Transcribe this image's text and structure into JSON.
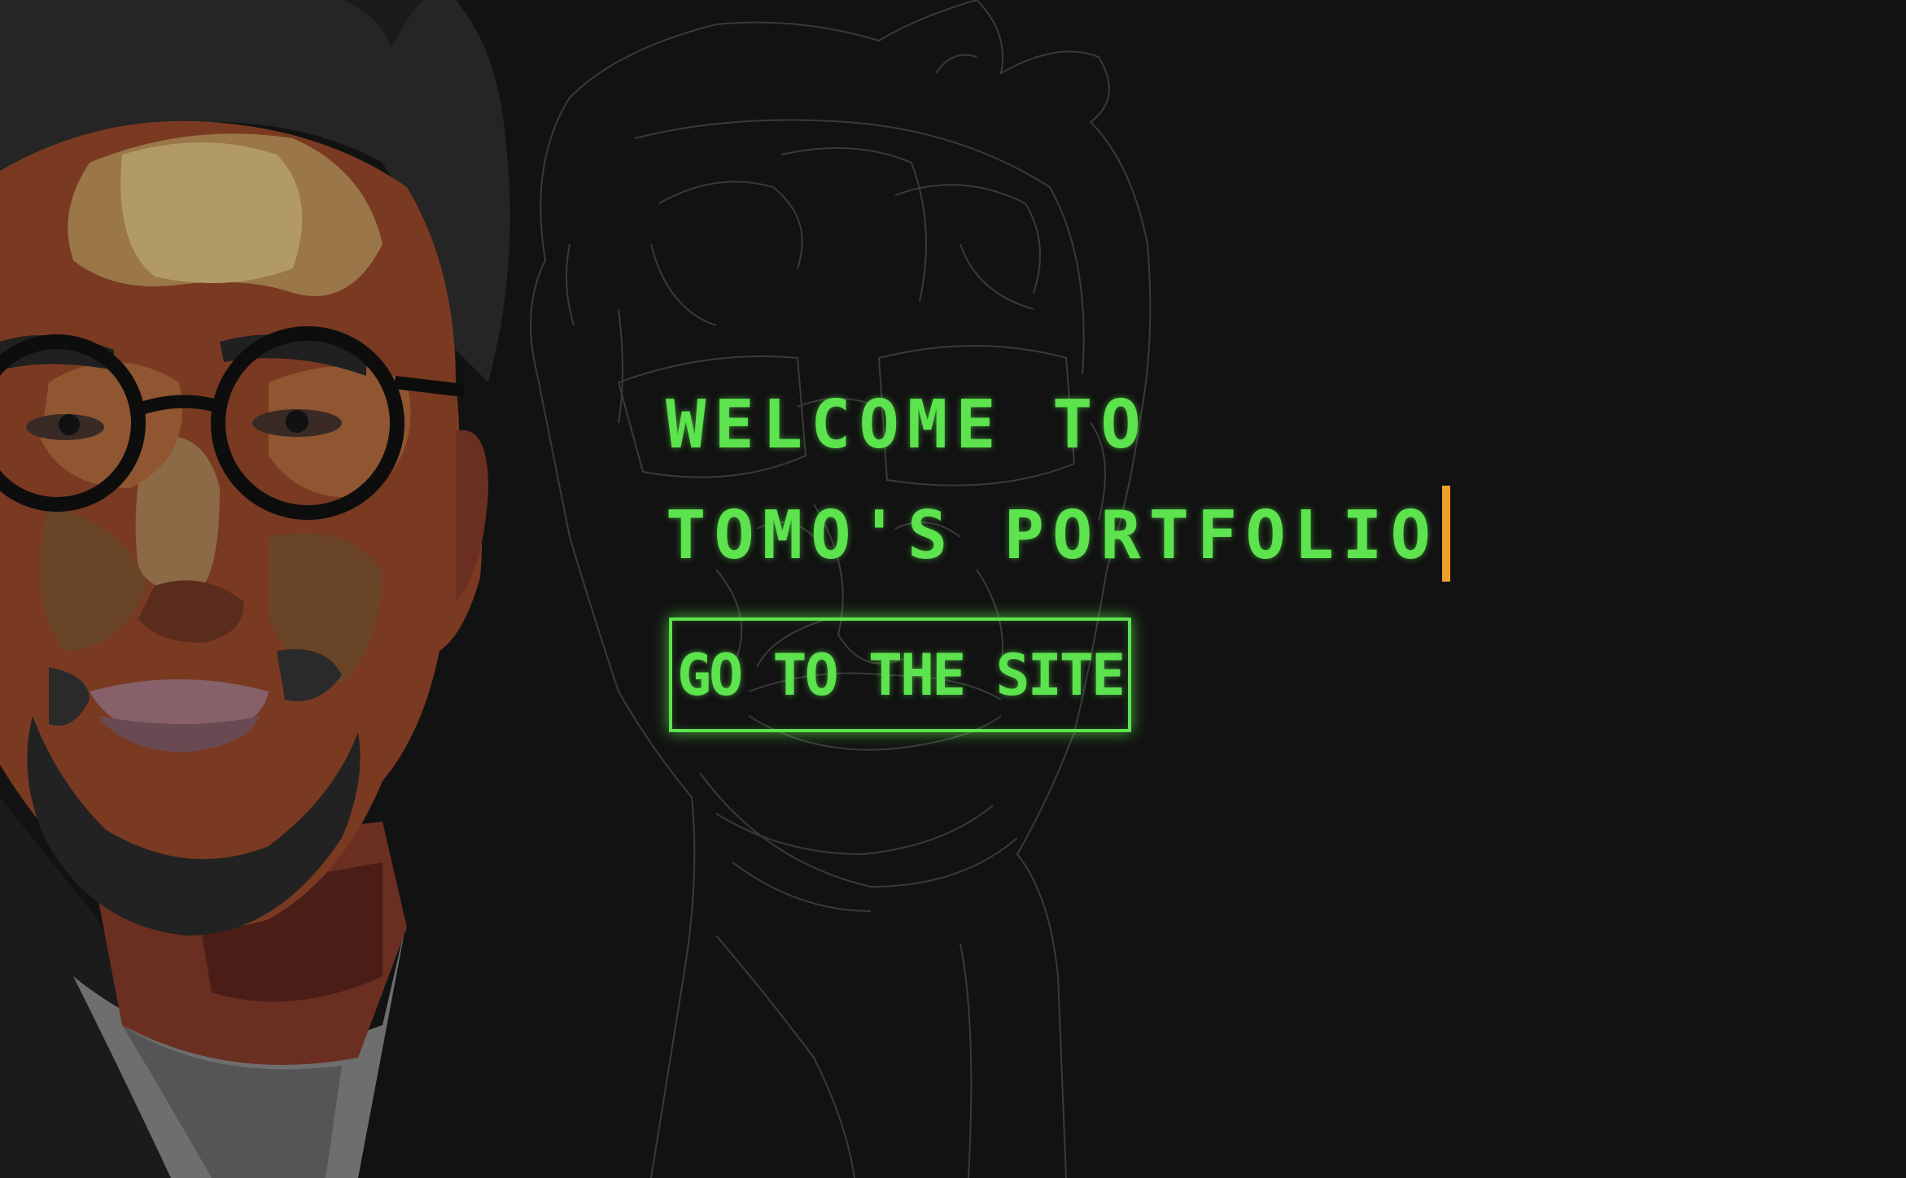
{
  "hero": {
    "headline_line1": "WELCOME TO",
    "headline_line2": "TOMO'S PORTFOLIO",
    "cta_label": "GO TO THE SITE"
  },
  "colors": {
    "background": "#121212",
    "accent_green": "#5ce34e",
    "cursor_orange": "#f0a02a"
  },
  "images": {
    "portrait": "stylized-portrait-illustration",
    "line_art": "line-art-portrait-outline"
  }
}
